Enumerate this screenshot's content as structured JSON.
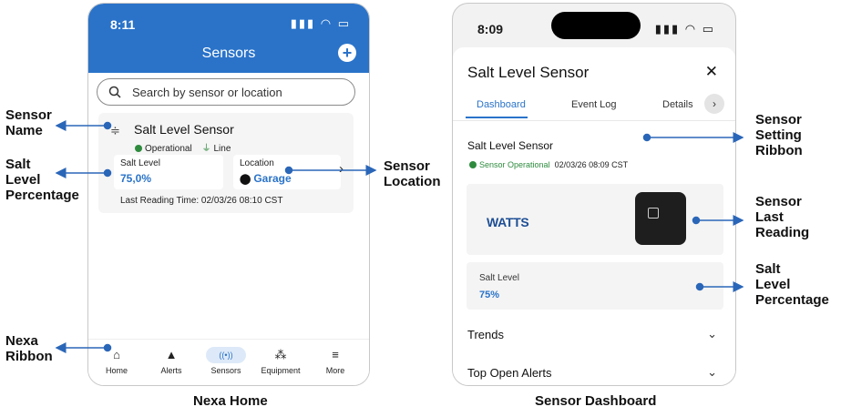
{
  "home": {
    "status_bar": {
      "time": "8:11",
      "icons": "▮▮▮ ◠ ▭"
    },
    "title": "Sensors",
    "add_icon": "plus-icon",
    "search": {
      "placeholder": "Search by sensor or location"
    },
    "card": {
      "name": "Salt Level Sensor",
      "status": "Operational",
      "power": "Line",
      "salt_label": "Salt Level",
      "salt_value": "75,0%",
      "location_label": "Location",
      "location_value": "Garage",
      "last_reading": "Last Reading Time:  02/03/26 08:10 CST"
    },
    "nav": [
      {
        "label": "Home",
        "icon": "home-icon",
        "glyph": "⌂"
      },
      {
        "label": "Alerts",
        "icon": "bell-icon",
        "glyph": "🔔"
      },
      {
        "label": "Sensors",
        "icon": "signal-icon",
        "glyph": "((•))"
      },
      {
        "label": "Equipment",
        "icon": "equipment-icon",
        "glyph": "⁂"
      },
      {
        "label": "More",
        "icon": "menu-icon",
        "glyph": "≡"
      }
    ]
  },
  "dashboard": {
    "status_bar": {
      "time": "8:09",
      "icons": "▮▮▮ ◠ ▭"
    },
    "title": "Salt Level Sensor",
    "close_icon": "close-icon",
    "tabs": [
      "Dashboard",
      "Event Log",
      "Details"
    ],
    "sensor_name": "Salt Level Sensor",
    "status_text": "Sensor Operational",
    "status_time": "02/03/26 08:09 CST",
    "logo_text": "WATTS",
    "salt_label": "Salt Level",
    "salt_value": "75%",
    "sections": [
      "Trends",
      "Top Open Alerts"
    ]
  },
  "callouts": {
    "sensor_name": "Sensor\nName",
    "salt_level_percentage": "Salt\nLevel\nPercentage",
    "nexa_ribbon": "Nexa\nRibbon",
    "sensor_location": "Sensor\nLocation",
    "sensor_setting_ribbon": "Sensor\nSetting\nRibbon",
    "sensor_last_reading": "Sensor\nLast\nReading",
    "salt_level_percentage_right": "Salt\nLevel\nPercentage"
  },
  "captions": {
    "left": "Nexa Home",
    "right": "Sensor Dashboard"
  },
  "colors": {
    "header_blue": "#2a73c9",
    "status_green": "#2e8b3e",
    "arrow_blue": "#2a66b8"
  }
}
